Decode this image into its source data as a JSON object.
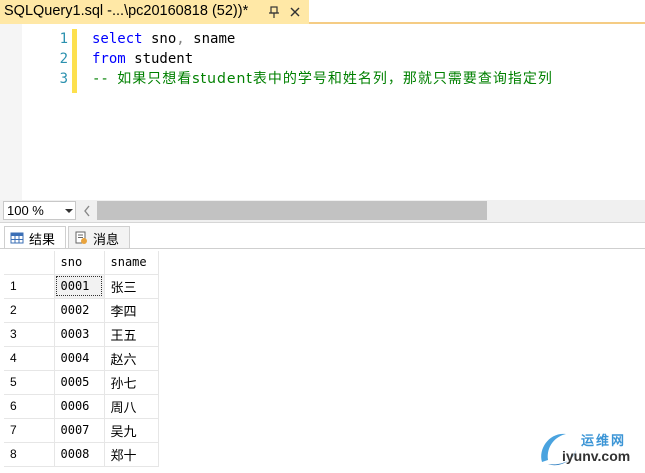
{
  "document_tab": {
    "title": "SQLQuery1.sql -...\\pc20160818 (52))*"
  },
  "editor": {
    "line_numbers": [
      "1",
      "2",
      "3"
    ],
    "line1": {
      "kw": "select",
      "rest": " sno",
      "comma": ",",
      "rest2": " sname"
    },
    "line2": {
      "kw": "from",
      "rest": " student"
    },
    "line3": {
      "comment_prefix": "-- ",
      "comment_text": "如果只想看student表中的学号和姓名列，那就只需要查询指定列"
    }
  },
  "zoom": {
    "value": "100 %"
  },
  "results_tabs": [
    {
      "label": "结果",
      "icon": "grid-icon"
    },
    {
      "label": "消息",
      "icon": "messages-icon"
    }
  ],
  "grid": {
    "columns": [
      "sno",
      "sname"
    ],
    "rows": [
      {
        "num": "1",
        "sno": "0001",
        "sname": "张三"
      },
      {
        "num": "2",
        "sno": "0002",
        "sname": "李四"
      },
      {
        "num": "3",
        "sno": "0003",
        "sname": "王五"
      },
      {
        "num": "4",
        "sno": "0004",
        "sname": "赵六"
      },
      {
        "num": "5",
        "sno": "0005",
        "sname": "孙七"
      },
      {
        "num": "6",
        "sno": "0006",
        "sname": "周八"
      },
      {
        "num": "7",
        "sno": "0007",
        "sname": "吴九"
      },
      {
        "num": "8",
        "sno": "0008",
        "sname": "郑十"
      }
    ]
  },
  "watermark": {
    "top_text": "运维网",
    "bottom_text": "iyunv.com"
  },
  "colors": {
    "tab_active": "#ffe8a6",
    "keyword": "#0000ff",
    "comment": "#008000",
    "line_number": "#2b91af",
    "change_bar": "#fde04d"
  }
}
